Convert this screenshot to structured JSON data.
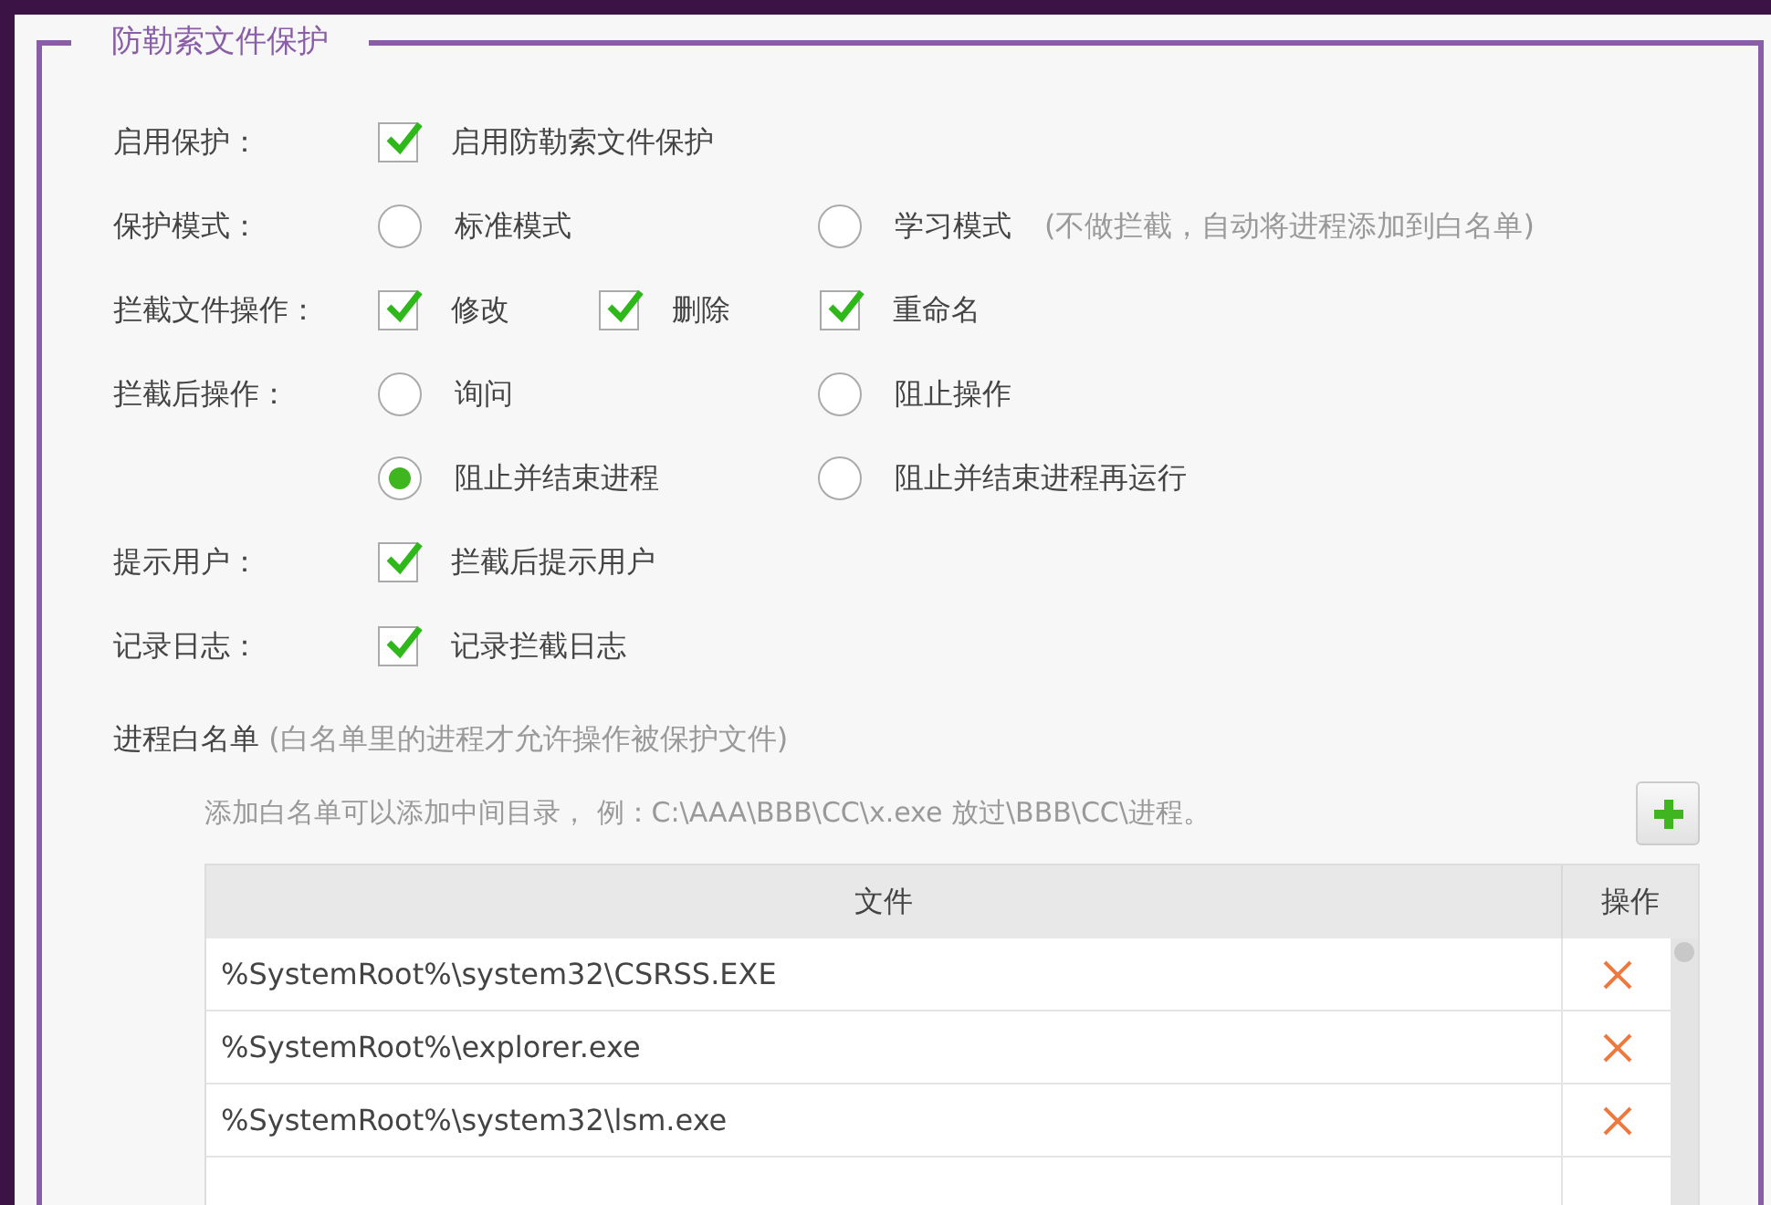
{
  "group": {
    "title": "防勒索文件保护"
  },
  "settings": [
    {
      "label": "启用保护：",
      "options": [
        {
          "kind": "checkbox",
          "text": "启用防勒索文件保护",
          "checked": true
        }
      ]
    },
    {
      "label": "保护模式：",
      "options": [
        {
          "kind": "radio",
          "text": "标准模式",
          "selected": false
        },
        {
          "kind": "radio",
          "text": "学习模式",
          "note": "(不做拦截，自动将进程添加到白名单)",
          "selected": false
        }
      ]
    },
    {
      "label": "拦截文件操作：",
      "options": [
        {
          "kind": "checkbox",
          "text": "修改",
          "checked": true
        },
        {
          "kind": "checkbox",
          "text": "删除",
          "checked": true
        },
        {
          "kind": "checkbox",
          "text": "重命名",
          "checked": true
        }
      ]
    },
    {
      "label": "拦截后操作：",
      "options": [
        {
          "kind": "radio",
          "text": "询问",
          "selected": false
        },
        {
          "kind": "radio",
          "text": "阻止操作",
          "selected": false
        }
      ]
    },
    {
      "options": [
        {
          "kind": "radio",
          "text": "阻止并结束进程",
          "selected": true
        },
        {
          "kind": "radio",
          "text": "阻止并结束进程再运行",
          "selected": false
        }
      ]
    },
    {
      "label": "提示用户：",
      "options": [
        {
          "kind": "checkbox",
          "text": "拦截后提示用户",
          "checked": true
        }
      ]
    },
    {
      "label": "记录日志：",
      "options": [
        {
          "kind": "checkbox",
          "text": "记录拦截日志",
          "checked": true
        }
      ]
    }
  ],
  "whitelist": {
    "title": "进程白名单",
    "note": "(白名单里的进程才允许操作被保护文件)",
    "hint": "添加白名单可以添加中间目录， 例：C:\\AAA\\BBB\\CC\\x.exe 放过\\BBB\\CC\\进程。",
    "table": {
      "columns": [
        "文件",
        "操作"
      ],
      "rows": [
        {
          "file": "%SystemRoot%\\system32\\CSRSS.EXE"
        },
        {
          "file": "%SystemRoot%\\explorer.exe"
        },
        {
          "file": "%SystemRoot%\\system32\\lsm.exe"
        }
      ]
    }
  }
}
